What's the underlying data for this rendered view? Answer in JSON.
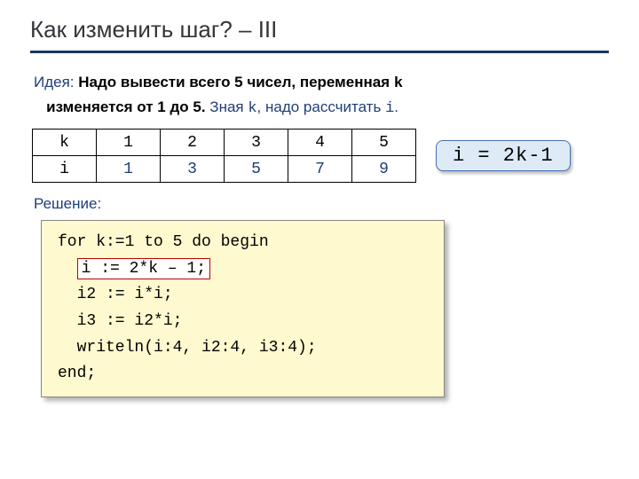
{
  "title": "Как изменить шаг? – III",
  "idea": {
    "label": "Идея:",
    "bold1": "Надо вывести всего 5 чисел, переменная ",
    "var1": "k",
    "bold2": " изменяется от 1 до 5.",
    "tail1": " Зная ",
    "var2": "k",
    "tail2": ", надо рассчитать",
    "var3": "i",
    "tail3": "."
  },
  "table": {
    "header": [
      "k",
      "1",
      "2",
      "3",
      "4",
      "5"
    ],
    "row": [
      "i",
      "1",
      "3",
      "5",
      "7",
      "9"
    ]
  },
  "formula": "i = 2k-1",
  "solution_label": "Решение:",
  "code": {
    "l1": "for k:=1 to 5 do begin",
    "l2": "i := 2*k – 1;",
    "l3": "  i2 := i*i;",
    "l4": "  i3 := i2*i;",
    "l5": "  writeln(i:4, i2:4, i3:4);",
    "l6": "end;"
  }
}
